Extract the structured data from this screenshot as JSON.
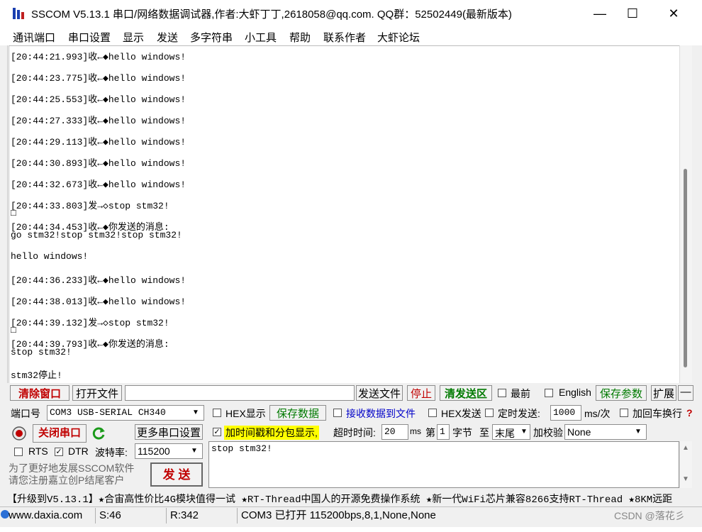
{
  "window": {
    "title": "SSCOM V5.13.1 串口/网络数据调试器,作者:大虾丁丁,2618058@qq.com. QQ群：52502449(最新版本)",
    "minimize": "—",
    "maximize": "☐",
    "close": "✕"
  },
  "menu": [
    "通讯端口",
    "串口设置",
    "显示",
    "发送",
    "多字符串",
    "小工具",
    "帮助",
    "联系作者",
    "大虾论坛"
  ],
  "log": [
    "[20:44:21.993]收←◆hello windows!",
    "[20:44:23.775]收←◆hello windows!",
    "[20:44:25.553]收←◆hello windows!",
    "[20:44:27.333]收←◆hello windows!",
    "[20:44:29.113]收←◆hello windows!",
    "[20:44:30.893]收←◆hello windows!",
    "[20:44:32.673]收←◆hello windows!",
    "[20:44:33.803]发→◇stop stm32!",
    "□",
    "[20:44:34.453]收←◆你发送的消息:",
    "go stm32!stop stm32!stop stm32!",
    "hello windows!",
    "[20:44:36.233]收←◆hello windows!",
    "[20:44:38.013]收←◆hello windows!",
    "[20:44:39.132]发→◇stop stm32!",
    "□",
    "[20:44:39.793]收←◆你发送的消息:",
    "stop stm32!",
    "stm32停止!"
  ],
  "toolbar": {
    "clear_window": "清除窗口",
    "open_file": "打开文件",
    "file_path": "",
    "send_file": "发送文件",
    "stop": "停止",
    "clear_send": "清发送区",
    "latest_label": "最前",
    "english_label": "English",
    "save_params": "保存参数",
    "expand": "扩展",
    "collapse": "—"
  },
  "port": {
    "port_label": "端口号",
    "port_value": "COM3 USB-SERIAL CH340",
    "close_port": "关闭串口",
    "more_settings": "更多串口设置",
    "rts_label": "RTS",
    "dtr_label": "DTR",
    "baud_label": "波特率:",
    "baud_value": "115200"
  },
  "options": {
    "hex_display": "HEX显示",
    "save_data": "保存数据",
    "recv_to_file": "接收数据到文件",
    "hex_send": "HEX发送",
    "timed_send": "定时发送:",
    "interval": "1000",
    "interval_unit": "ms/次",
    "add_crlf": "加回车换行",
    "timestamp": "加时间戳和分包显示,",
    "timeout_label": "超时时间:",
    "timeout_value": "20",
    "timeout_unit": "ms",
    "byte_label_1": "第",
    "byte_index": "1",
    "byte_label_2": "字节",
    "to_label": "至",
    "to_value": "末尾",
    "checksum_label": "加校验",
    "checksum_value": "None"
  },
  "send": {
    "text": "stop stm32!",
    "send_button": "发 送",
    "promo": "为了更好地发展SSCOM软件\n请您注册嘉立创P结尾客户"
  },
  "ticker": "【升级到V5.13.1】★合宙高性价比4G模块值得一试 ★RT-Thread中国人的开源免费操作系统 ★新一代WiFi芯片兼容8266支持RT-Thread ★8KM远距",
  "status": {
    "website": "www.daxia.com",
    "sent": "S:46",
    "received": "R:342",
    "port_state": "COM3 已打开  115200bps,8,1,None,None",
    "watermark": "CSDN @落花彡"
  },
  "colors": {
    "accent_red": "#c00000",
    "green_text": "#007a00",
    "blue_text": "#0000c8",
    "highlight": "#ffff00"
  }
}
